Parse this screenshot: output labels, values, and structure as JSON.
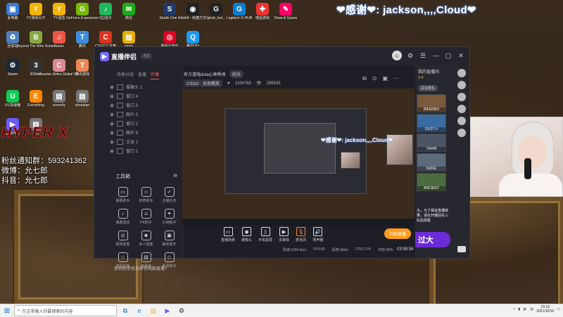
{
  "overlay": {
    "thanks": "❤感谢❤: jackson,,,,Cloud❤",
    "thanks_small": "❤感谢❤: jackson,,,,Cloud❤",
    "fans_group": "粉丝通知群：593241362",
    "weibo": "微博：允七郎",
    "douyin": "抖音：允七郎",
    "brand": "HYPER X"
  },
  "desktop_icons": [
    {
      "label": "此电脑",
      "color": "#3a7bd5",
      "glyph": "▣"
    },
    {
      "label": "YY游戏大厅",
      "color": "#f5b400",
      "glyph": "Y"
    },
    {
      "label": "YY语音",
      "color": "#f5b400",
      "glyph": "Y"
    },
    {
      "label": "GeForce Experience",
      "color": "#76b900",
      "glyph": "G"
    },
    {
      "label": "QQ音乐",
      "color": "#1fb95b",
      "glyph": "♪"
    },
    {
      "label": "微信",
      "color": "#1aad19",
      "glyph": "✉"
    },
    {
      "label": "Studio One 5",
      "color": "#1f3b6b",
      "glyph": "S"
    },
    {
      "label": "obs64 - 快捷方式",
      "color": "#222",
      "glyph": "◉"
    },
    {
      "label": "lghub_inst...",
      "color": "#222",
      "glyph": "G"
    },
    {
      "label": "Logitech G HUB",
      "color": "#0b7fd1",
      "glyph": "G"
    },
    {
      "label": "喂血游戏",
      "color": "#e33",
      "glyph": "✚"
    },
    {
      "label": "Draw & Guess",
      "color": "#f06",
      "glyph": "✎"
    },
    {
      "label": "回收站",
      "color": "#4f7fbf",
      "glyph": "♻"
    },
    {
      "label": "Beyond The Wire Sound",
      "color": "#8a4",
      "glyph": "B"
    },
    {
      "label": "Itunes",
      "color": "#e54",
      "glyph": "♫"
    },
    {
      "label": "腾讯",
      "color": "#3c8de0",
      "glyph": "T"
    },
    {
      "label": "CSGO工具箱",
      "color": "#d32",
      "glyph": "C"
    },
    {
      "label": "game",
      "color": "#e5b000",
      "glyph": "▤"
    },
    {
      "label": "网易云音乐",
      "color": "#d02",
      "glyph": "◎"
    },
    {
      "label": "腾讯QQ",
      "color": "#1d9bf0",
      "glyph": "Q"
    },
    {
      "label": "Steam",
      "color": "#1b2838",
      "glyph": "⚙"
    },
    {
      "label": "3DMark",
      "color": "#333",
      "glyph": "3"
    },
    {
      "label": "Counter-Strike Global Off.",
      "color": "#d89",
      "glyph": "C"
    },
    {
      "label": "腾讯游戏",
      "color": "#e85",
      "glyph": "T"
    },
    {
      "label": "UU加速器",
      "color": "#1c5",
      "glyph": "U"
    },
    {
      "label": "Everything",
      "color": "#f80",
      "glyph": "E"
    },
    {
      "label": "svencity",
      "color": "#777",
      "glyph": "▤"
    },
    {
      "label": "sheepian",
      "color": "#777",
      "glyph": "▤"
    },
    {
      "label": "直播伴侣",
      "color": "#6a5cff",
      "glyph": "▶"
    },
    {
      "label": "全新",
      "color": "#777",
      "glyph": "▤"
    }
  ],
  "app": {
    "name": "直播伴侣",
    "version": "4.0",
    "left_tabs": [
      "场景分组",
      "直播",
      "开播"
    ],
    "active_tab": "开播",
    "sources": [
      {
        "name": "摄像头 1"
      },
      {
        "name": "窗口 4"
      },
      {
        "name": "窗口 3"
      },
      {
        "name": "图片 5"
      },
      {
        "name": "窗口 2"
      },
      {
        "name": "图片 6"
      },
      {
        "name": "文本 1"
      },
      {
        "name": "窗口 1"
      }
    ],
    "tools_title": "工具箱",
    "tools": [
      {
        "label": "弹幕助手",
        "glyph": "▭"
      },
      {
        "label": "房管助手",
        "glyph": "☺"
      },
      {
        "label": "主播任务",
        "glyph": "✓"
      },
      {
        "label": "弹幕录音",
        "glyph": "♪"
      },
      {
        "label": "PK助手",
        "glyph": "⚔"
      },
      {
        "label": "礼物助手",
        "glyph": "✦"
      },
      {
        "label": "视频连麦",
        "glyph": "◎"
      },
      {
        "label": "多人连麦",
        "glyph": "☻"
      },
      {
        "label": "抽奖助手",
        "glyph": "▣"
      },
      {
        "label": "虚拟形象",
        "glyph": "☆"
      },
      {
        "label": "弹幕墙",
        "glyph": "▤"
      },
      {
        "label": "新闻助手",
        "glyph": "◇"
      }
    ],
    "notice": "如何把手机投屏到电脑直播?",
    "room_title": "有方游戏dota心神秀场",
    "edit_label": "修改",
    "category": "CSGO · 反恐精英",
    "fans_count": "1334765",
    "online_count": "296535",
    "toolbar": [
      {
        "label": "直播场景",
        "glyph": "▭"
      },
      {
        "label": "摄像头",
        "glyph": "◉"
      },
      {
        "label": "手机投屏",
        "glyph": "▯"
      },
      {
        "label": "多媒体",
        "glyph": "▶"
      },
      {
        "label": "麦克风",
        "glyph": "🎙"
      },
      {
        "label": "扬声器",
        "glyph": "🔊"
      }
    ],
    "start_label": "开始直播",
    "status": [
      "网速:1964 kb/s",
      "FPS:60",
      "码率:0kb/s",
      "CPU:17%",
      "内存:28%"
    ],
    "timer": "03:59:58",
    "right_panel": {
      "header": "我的直播间",
      "level_label": "V 6",
      "follow_label": "关注有礼",
      "maps": [
        {
          "name": "INFERNO",
          "color": "#7a5a3b"
        },
        {
          "name": "DUST II",
          "color": "#3b6aa0"
        },
        {
          "name": "TRAIN",
          "color": "#4b5566"
        },
        {
          "name": "NUKE",
          "color": "#5b6b7b"
        },
        {
          "name": "ANCIENT",
          "color": "#4c6b3e"
        }
      ],
      "chat": "大。为了保证直播效果，请在开播前先入队后观看",
      "big_button": "过大"
    }
  },
  "taskbar": {
    "search_placeholder": "在这里输入你要搜索的内容",
    "time": "15:16",
    "date": "2021/10/16",
    "lang": "中"
  }
}
